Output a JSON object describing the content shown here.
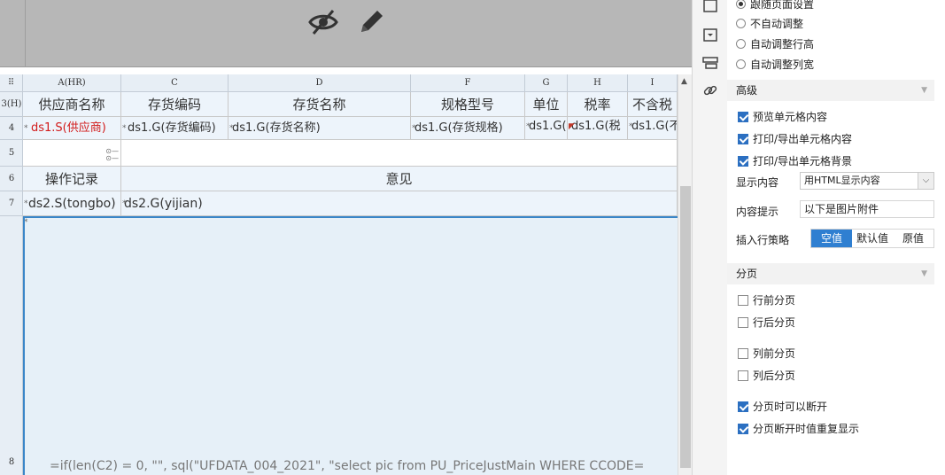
{
  "preview": {
    "icons": [
      "eye-off-icon",
      "pencil-icon"
    ]
  },
  "columns": [
    "A(HR)",
    "C",
    "D",
    "F",
    "G",
    "H",
    "I"
  ],
  "rows": [
    "3(H)",
    "4",
    "5",
    "6",
    "7",
    "8"
  ],
  "header_row": [
    "供应商名称",
    "存货编码",
    "存货名称",
    "规格型号",
    "单位",
    "税率",
    "不含税"
  ],
  "data_row": [
    "ds1.S(供应商)",
    "ds1.G(存货编码)",
    "ds1.G(存货名称)",
    "ds1.G(存货规格)",
    "ds1.G(",
    "ds1.G(税",
    "ds1.G(不"
  ],
  "row6": [
    "操作记录",
    "意见"
  ],
  "row7": [
    "ds2.S(tongbo)",
    "ds2.G(yijian)"
  ],
  "formula": "=if(len(C2) = 0, \"\", sql(\"UFDATA_004_2021\", \"select  pic from  PU_PriceJustMain WHERE  CCODE=",
  "toolbar_icons": [
    "cell-style-icon",
    "dropdown-widget-icon",
    "print-icon",
    "hyperlink-icon"
  ],
  "props": {
    "radios": [
      {
        "label": "跟随页面设置",
        "on": true
      },
      {
        "label": "不自动调整",
        "on": false
      },
      {
        "label": "自动调整行高",
        "on": false
      },
      {
        "label": "自动调整列宽",
        "on": false
      }
    ],
    "advanced_title": "高级",
    "advanced_checks": [
      {
        "label": "预览单元格内容",
        "on": true
      },
      {
        "label": "打印/导出单元格内容",
        "on": true
      },
      {
        "label": "打印/导出单元格背景",
        "on": true
      }
    ],
    "display_label": "显示内容",
    "display_value": "用HTML显示内容",
    "tip_label": "内容提示",
    "tip_value": "以下是图片附件",
    "insert_label": "插入行策略",
    "insert_options": [
      "空值",
      "默认值",
      "原值"
    ],
    "insert_selected": 0,
    "paging_title": "分页",
    "paging_checks": [
      {
        "label": "行前分页",
        "on": false
      },
      {
        "label": "行后分页",
        "on": false
      },
      {
        "label": "列前分页",
        "on": false
      },
      {
        "label": "列后分页",
        "on": false
      },
      {
        "label": "分页时可以断开",
        "on": true
      },
      {
        "label": "分页断开时值重复显示",
        "on": true
      }
    ]
  }
}
